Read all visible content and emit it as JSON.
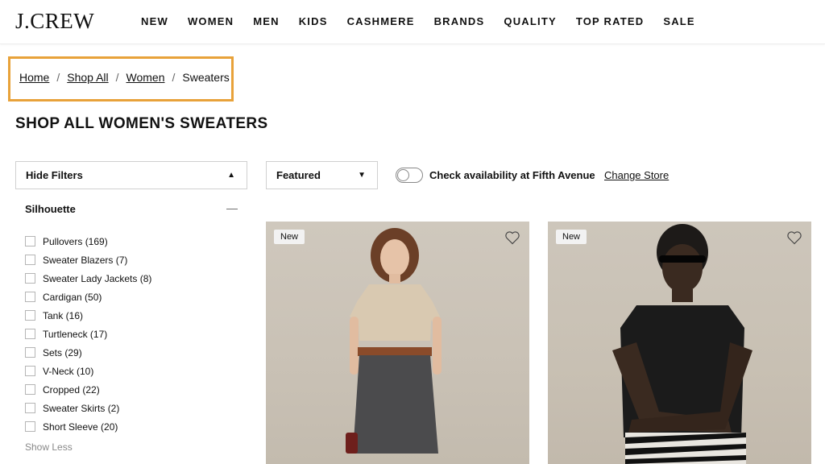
{
  "header": {
    "logo": "J.CREW",
    "nav": [
      "NEW",
      "WOMEN",
      "MEN",
      "KIDS",
      "CASHMERE",
      "BRANDS",
      "QUALITY",
      "TOP RATED",
      "SALE"
    ]
  },
  "breadcrumb": {
    "links": [
      "Home",
      "Shop All",
      "Women"
    ],
    "separator": "/",
    "current": "Sweaters"
  },
  "page_title": "SHOP ALL WOMEN'S SWEATERS",
  "controls": {
    "hide_filters": "Hide Filters",
    "sort": "Featured",
    "store_label": "Check availability at Fifth Avenue",
    "change_store": "Change Store",
    "store_toggle_on": false
  },
  "filters": {
    "title": "Silhouette",
    "items": [
      "Pullovers (169)",
      "Sweater Blazers (7)",
      "Sweater Lady Jackets (8)",
      "Cardigan (50)",
      "Tank (16)",
      "Turtleneck (17)",
      "Sets (29)",
      "V-Neck (10)",
      "Cropped (22)",
      "Sweater Skirts (2)",
      "Short Sleeve (20)"
    ],
    "show_less": "Show Less"
  },
  "products": [
    {
      "badge": "New"
    },
    {
      "badge": "New"
    }
  ],
  "colors": {
    "highlight_border": "#e8a23a"
  }
}
